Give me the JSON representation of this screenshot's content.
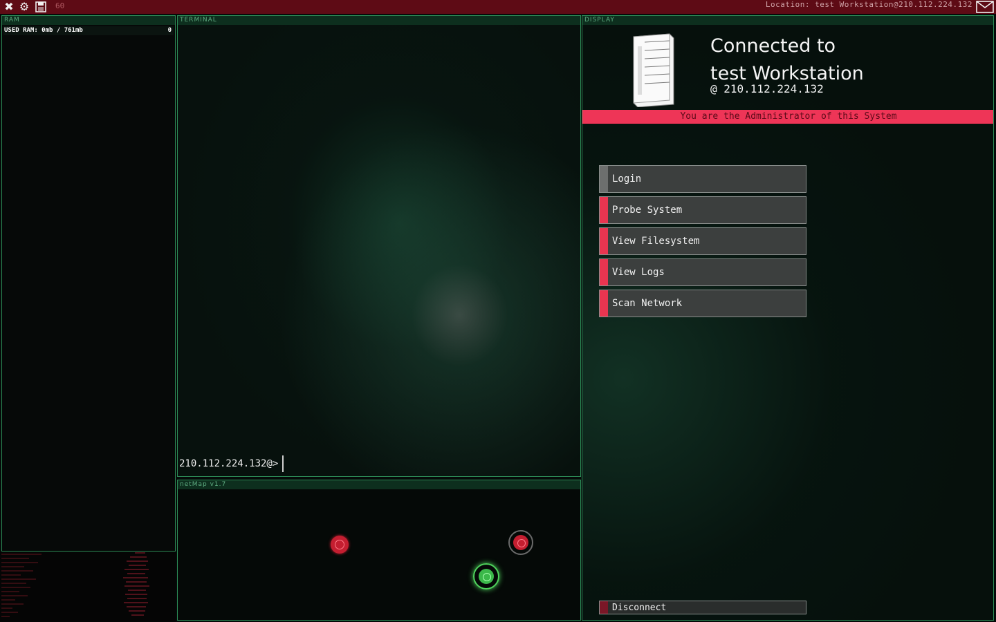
{
  "topbar": {
    "count": "60",
    "location": "Location: test Workstation@210.112.224.132"
  },
  "ram": {
    "header": "RAM",
    "used_label": "USED RAM: 0mb / 761mb",
    "used_count": "0"
  },
  "terminal": {
    "header": "TERMINAL",
    "prompt": "210.112.224.132@>"
  },
  "netmap": {
    "header": "netMap v1.7"
  },
  "display": {
    "header": "DISPLAY",
    "connected_line1": "Connected to",
    "connected_line2": "test Workstation",
    "ip": "@  210.112.224.132",
    "admin_notice": "You are the Administrator of this System",
    "buttons": {
      "login": "Login",
      "probe": "Probe System",
      "filesystem": "View Filesystem",
      "logs": "View Logs",
      "scan": "Scan Network",
      "disconnect": "Disconnect"
    }
  },
  "icons": [
    "close-icon",
    "settings-icon",
    "save-icon",
    "mail-icon",
    "server-icon"
  ],
  "colors": {
    "topbar": "#5e0b15",
    "panel_border": "#2c8a55",
    "accent_red": "#ee3557",
    "node_red": "#c41e30",
    "node_green": "#4fd35c"
  }
}
